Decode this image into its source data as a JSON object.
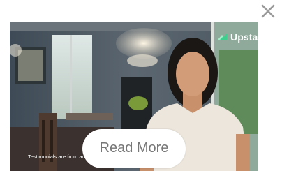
{
  "close": {
    "icon": "close-icon",
    "color": "#9a9a9a"
  },
  "video": {
    "brand": {
      "name": "Upstart",
      "color": "#ffffff",
      "accent": "#3ecf8e",
      "icon": "upstart-logo-icon"
    },
    "disclaimer": "Testimonials are from actual U"
  },
  "cta": {
    "label": "Read More"
  }
}
